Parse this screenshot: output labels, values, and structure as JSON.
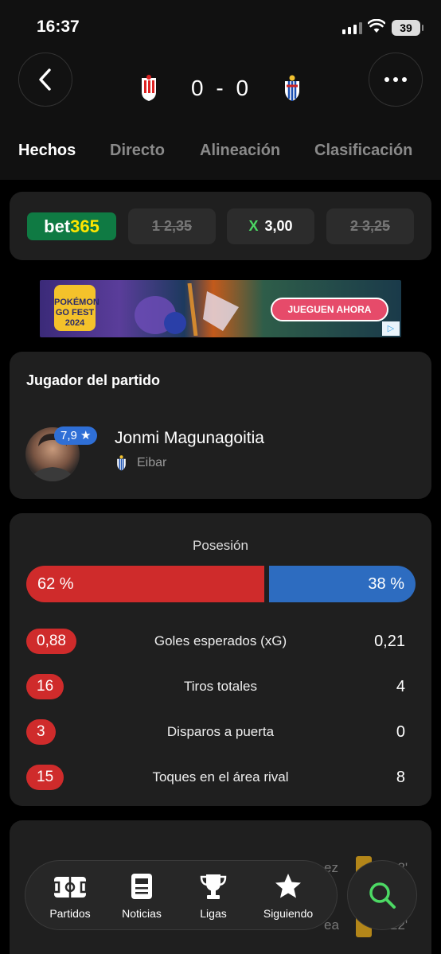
{
  "status_bar": {
    "time": "16:37",
    "battery": "39"
  },
  "match": {
    "home_score": "0",
    "separator": "-",
    "away_score": "0",
    "tabs": [
      {
        "label": "Hechos",
        "active": true
      },
      {
        "label": "Directo",
        "active": false
      },
      {
        "label": "Alineación",
        "active": false
      },
      {
        "label": "Clasificación",
        "active": false
      }
    ]
  },
  "odds": {
    "provider_prefix": "bet",
    "provider_suffix": "365",
    "home": {
      "label": "1",
      "value": "2,35"
    },
    "draw": {
      "label": "X",
      "value": "3,00"
    },
    "away": {
      "label": "2",
      "value": "3,25"
    }
  },
  "ad": {
    "brand_text": "POKÉMON GO FEST 2024",
    "cta": "JUEGUEN AHORA"
  },
  "player_of_match": {
    "title": "Jugador del partido",
    "rating": "7,9",
    "name": "Jonmi Magunagoitia",
    "team": "Eibar"
  },
  "stats": {
    "possession_title": "Posesión",
    "possession_home": "62 %",
    "possession_away": "38 %",
    "possession_home_fraction": 0.62,
    "rows": [
      {
        "home": "0,88",
        "label": "Goles esperados (xG)",
        "away": "0,21"
      },
      {
        "home": "16",
        "label": "Tiros totales",
        "away": "4"
      },
      {
        "home": "3",
        "label": "Disparos a puerta",
        "away": "0"
      },
      {
        "home": "15",
        "label": "Toques en el área rival",
        "away": "8"
      }
    ]
  },
  "events_ghost": {
    "a": "ez",
    "a_time": "18'",
    "b": "ea",
    "b_time": "22'"
  },
  "nav": {
    "items": [
      {
        "label": "Partidos",
        "icon": "pitch-icon"
      },
      {
        "label": "Noticias",
        "icon": "news-icon"
      },
      {
        "label": "Ligas",
        "icon": "trophy-icon"
      },
      {
        "label": "Siguiendo",
        "icon": "star-icon"
      }
    ],
    "search_icon": "search-icon"
  },
  "colors": {
    "home": "#cf2b2b",
    "away": "#2d6cc0",
    "accent_green": "#4cd964",
    "rating_blue": "#2f6fd6"
  }
}
